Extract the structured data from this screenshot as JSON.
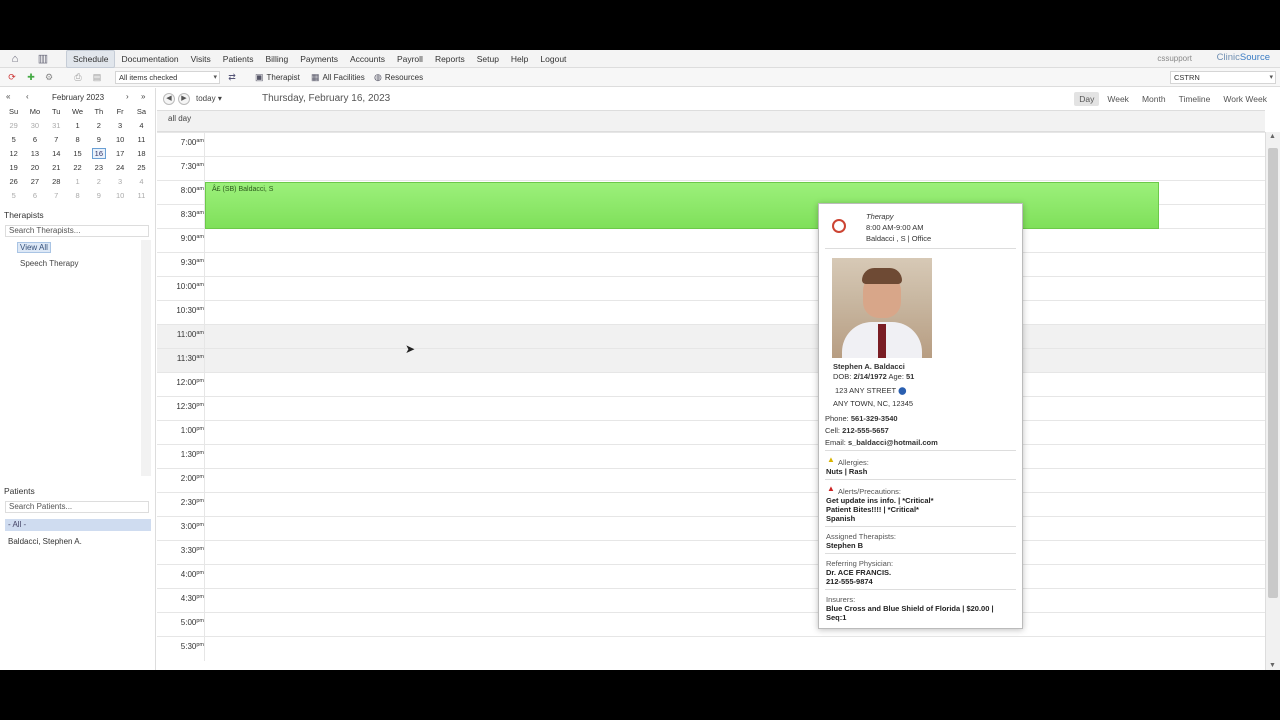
{
  "nav": {
    "items": [
      "Schedule",
      "Documentation",
      "Visits",
      "Patients",
      "Billing",
      "Payments",
      "Accounts",
      "Payroll",
      "Reports",
      "Setup",
      "Help",
      "Logout"
    ],
    "active": "Schedule",
    "user": "cssupport",
    "logo_a": "Clinic",
    "logo_b": "Source"
  },
  "toolbar": {
    "filter_select": "All items checked",
    "therapist_btn": "Therapist",
    "facilities_btn": "All Facilities",
    "resources_btn": "Resources",
    "location_select": "CSTRN"
  },
  "mini_calendar": {
    "month": "February 2023",
    "days_header": [
      "Su",
      "Mo",
      "Tu",
      "We",
      "Th",
      "Fr",
      "Sa"
    ],
    "weeks": [
      [
        "29",
        "30",
        "31",
        "1",
        "2",
        "3",
        "4"
      ],
      [
        "5",
        "6",
        "7",
        "8",
        "9",
        "10",
        "11"
      ],
      [
        "12",
        "13",
        "14",
        "15",
        "16",
        "17",
        "18"
      ],
      [
        "19",
        "20",
        "21",
        "22",
        "23",
        "24",
        "25"
      ],
      [
        "26",
        "27",
        "28",
        "1",
        "2",
        "3",
        "4"
      ],
      [
        "5",
        "6",
        "7",
        "8",
        "9",
        "10",
        "11"
      ]
    ],
    "today": "16"
  },
  "therapists": {
    "title": "Therapists",
    "search_placeholder": "Search Therapists...",
    "view_all": "View All",
    "items": [
      "Speech Therapy"
    ]
  },
  "patients": {
    "title": "Patients",
    "search_placeholder": "Search Patients...",
    "all_label": "- All -",
    "items": [
      "Baldacci, Stephen A."
    ]
  },
  "schedule": {
    "today_label": "today",
    "date_title": "Thursday, February 16, 2023",
    "views": [
      "Day",
      "Week",
      "Month",
      "Timeline",
      "Work Week"
    ],
    "active_view": "Day",
    "allday_label": "all day",
    "times": [
      [
        "7:00",
        "am"
      ],
      [
        "7:30",
        "am"
      ],
      [
        "8:00",
        "am"
      ],
      [
        "8:30",
        "am"
      ],
      [
        "9:00",
        "am"
      ],
      [
        "9:30",
        "am"
      ],
      [
        "10:00",
        "am"
      ],
      [
        "10:30",
        "am"
      ],
      [
        "11:00",
        "am"
      ],
      [
        "11:30",
        "am"
      ],
      [
        "12:00",
        "pm"
      ],
      [
        "12:30",
        "pm"
      ],
      [
        "1:00",
        "pm"
      ],
      [
        "1:30",
        "pm"
      ],
      [
        "2:00",
        "pm"
      ],
      [
        "2:30",
        "pm"
      ],
      [
        "3:00",
        "pm"
      ],
      [
        "3:30",
        "pm"
      ],
      [
        "4:00",
        "pm"
      ],
      [
        "4:30",
        "pm"
      ],
      [
        "5:00",
        "pm"
      ],
      [
        "5:30",
        "pm"
      ]
    ],
    "event_label": "Â£ (SB) Baldacci, S"
  },
  "popup": {
    "type": "Therapy",
    "time": "8:00 AM-9:00 AM",
    "who": "Baldacci , S | Office",
    "name": "Stephen A. Baldacci",
    "dob_label": "DOB:",
    "dob": "2/14/1972",
    "age_label": "Age:",
    "age": "51",
    "street": "123 ANY STREET",
    "city": "ANY TOWN, NC, 12345",
    "phone_label": "Phone:",
    "phone": "561-329-3540",
    "cell_label": "Cell:",
    "cell": "212-555-5657",
    "email_label": "Email:",
    "email": "s_baldacci@hotmail.com",
    "allergies_label": "Allergies:",
    "allergies": "Nuts | Rash",
    "alerts_label": "Alerts/Precautions:",
    "alerts": [
      "Get update ins info. | *Critical*",
      "Patient Bites!!!! | *Critical*",
      "Spanish"
    ],
    "assigned_label": "Assigned Therapists:",
    "assigned": "Stephen B",
    "referring_label": "Referring Physician:",
    "referring_name": "Dr. ACE FRANCIS.",
    "referring_phone": "212-555-9874",
    "insurers_label": "Insurers:",
    "insurers_1": "Blue Cross and Blue Shield of Florida | $20.00 |",
    "insurers_2": "Seq:1"
  }
}
